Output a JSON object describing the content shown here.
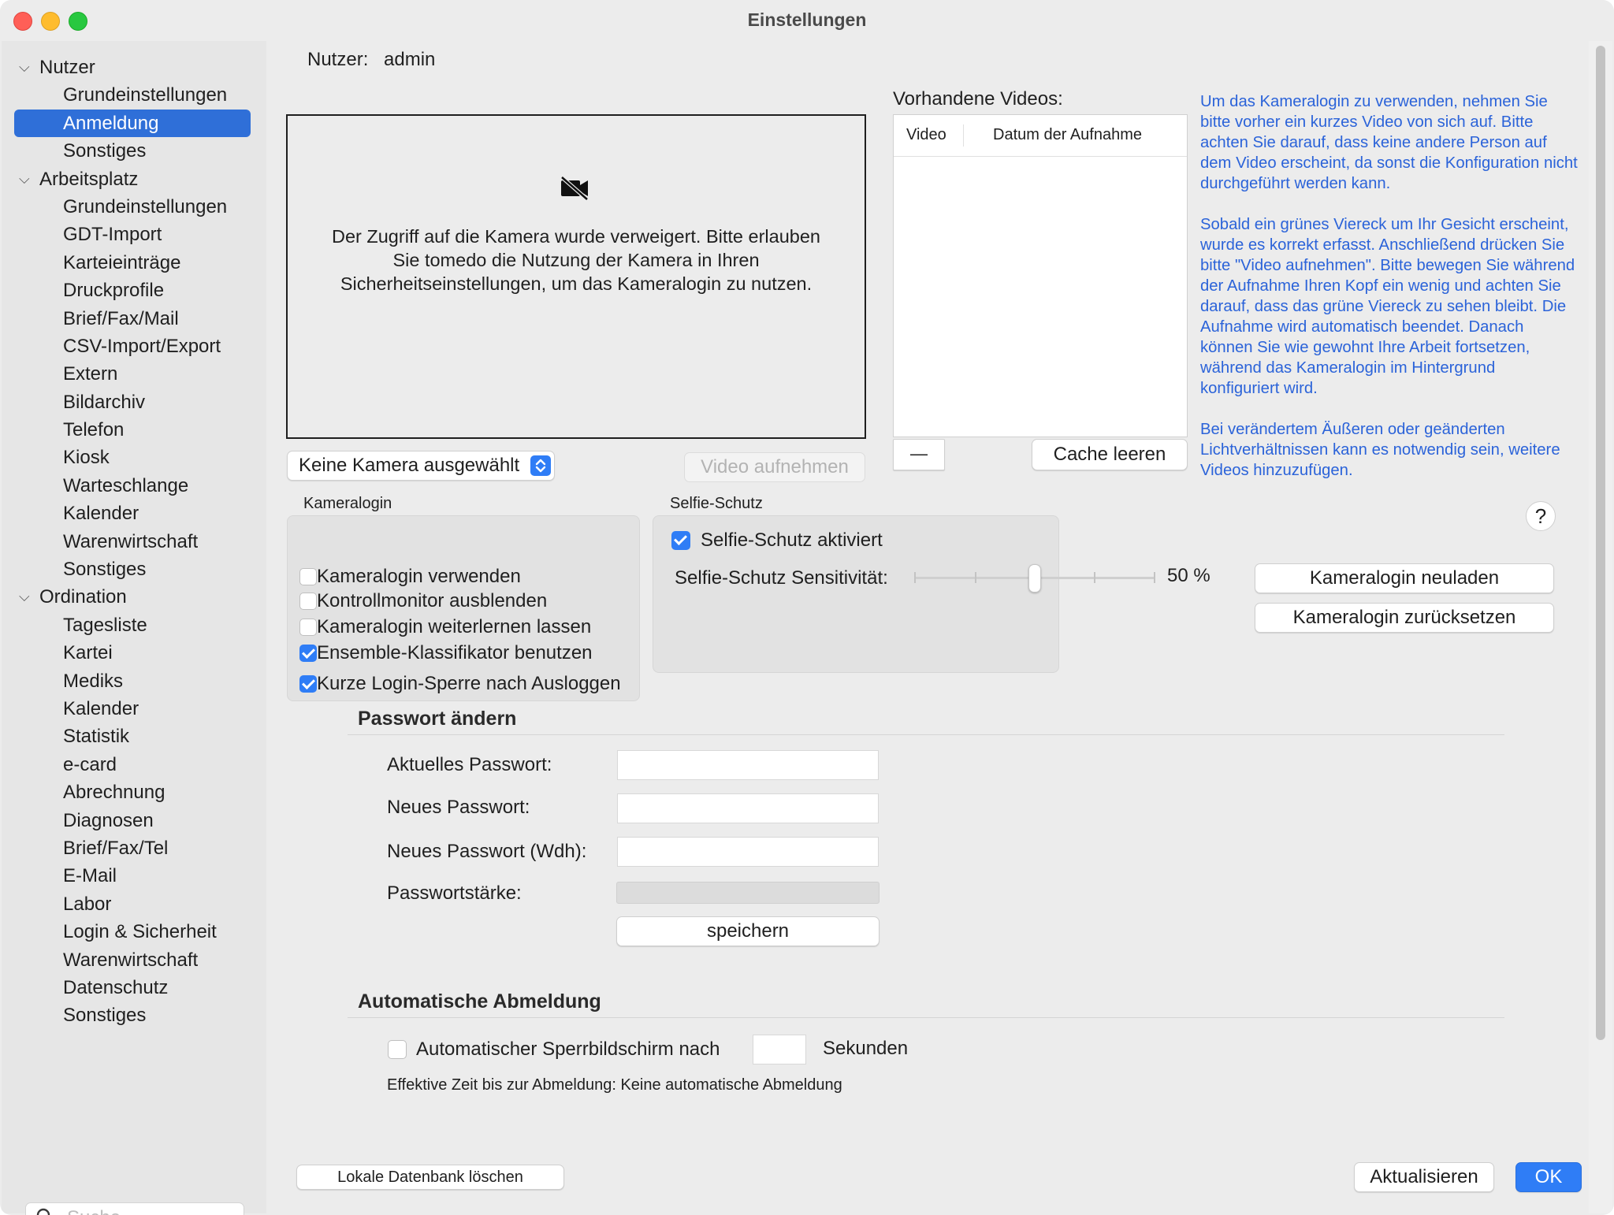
{
  "window": {
    "title": "Einstellungen"
  },
  "sidebar": {
    "items": [
      {
        "label": "Nutzer",
        "type": "group"
      },
      {
        "label": "Grundeinstellungen",
        "type": "child"
      },
      {
        "label": "Anmeldung",
        "type": "child",
        "selected": true
      },
      {
        "label": "Sonstiges",
        "type": "child"
      },
      {
        "label": "Arbeitsplatz",
        "type": "group"
      },
      {
        "label": "Grundeinstellungen",
        "type": "child"
      },
      {
        "label": "GDT-Import",
        "type": "child"
      },
      {
        "label": "Karteieinträge",
        "type": "child"
      },
      {
        "label": "Druckprofile",
        "type": "child"
      },
      {
        "label": "Brief/Fax/Mail",
        "type": "child"
      },
      {
        "label": "CSV-Import/Export",
        "type": "child"
      },
      {
        "label": "Extern",
        "type": "child"
      },
      {
        "label": "Bildarchiv",
        "type": "child"
      },
      {
        "label": "Telefon",
        "type": "child"
      },
      {
        "label": "Kiosk",
        "type": "child"
      },
      {
        "label": "Warteschlange",
        "type": "child"
      },
      {
        "label": "Kalender",
        "type": "child"
      },
      {
        "label": "Warenwirtschaft",
        "type": "child"
      },
      {
        "label": "Sonstiges",
        "type": "child"
      },
      {
        "label": "Ordination",
        "type": "group"
      },
      {
        "label": "Tagesliste",
        "type": "child"
      },
      {
        "label": "Kartei",
        "type": "child"
      },
      {
        "label": "Mediks",
        "type": "child"
      },
      {
        "label": "Kalender",
        "type": "child"
      },
      {
        "label": "Statistik",
        "type": "child"
      },
      {
        "label": "e-card",
        "type": "child"
      },
      {
        "label": "Abrechnung",
        "type": "child"
      },
      {
        "label": "Diagnosen",
        "type": "child"
      },
      {
        "label": "Brief/Fax/Tel",
        "type": "child"
      },
      {
        "label": "E-Mail",
        "type": "child"
      },
      {
        "label": "Labor",
        "type": "child"
      },
      {
        "label": "Login & Sicherheit",
        "type": "child"
      },
      {
        "label": "Warenwirtschaft",
        "type": "child"
      },
      {
        "label": "Datenschutz",
        "type": "child"
      },
      {
        "label": "Sonstiges",
        "type": "child"
      }
    ],
    "search_placeholder": "Suche"
  },
  "user": {
    "label": "Nutzer:",
    "value": "admin"
  },
  "camera": {
    "message": "Der Zugriff auf die Kamera wurde verweigert. Bitte erlauben Sie tomedo die Nutzung der Kamera in Ihren Sicherheitseinstellungen, um das Kameralogin zu nutzen.",
    "select_label": "Keine Kamera ausgewählt",
    "record_button": "Video aufnehmen"
  },
  "videos": {
    "title": "Vorhandene Videos:",
    "columns": [
      "Video",
      "Datum der Aufnahme"
    ],
    "remove_button": "—",
    "clear_cache_button": "Cache leeren"
  },
  "info": {
    "paragraphs": [
      "Um das Kameralogin zu verwenden, nehmen Sie bitte vorher ein kurzes Video von sich auf. Bitte achten Sie darauf, dass keine andere Person auf dem Video erscheint, da sonst die Konfiguration nicht durchgeführt werden kann.",
      "Sobald ein grünes Viereck um Ihr Gesicht erscheint, wurde es korrekt erfasst. Anschließend drücken Sie bitte \"Video aufnehmen\". Bitte bewegen Sie während der Aufnahme Ihren Kopf ein wenig und achten Sie darauf, dass das grüne Viereck zu sehen bleibt. Die Aufnahme wird automatisch beendet. Danach können Sie wie gewohnt Ihre Arbeit fortsetzen, während das Kameralogin im Hintergrund konfiguriert wird.",
      "Bei verändertem Äußeren oder geänderten Lichtverhältnissen kann es notwendig sein, weitere Videos hinzuzufügen."
    ],
    "help_label": "?"
  },
  "kameralogin": {
    "title": "Kameralogin",
    "options": [
      {
        "label": "Kameralogin verwenden",
        "checked": false
      },
      {
        "label": "Kontrollmonitor ausblenden",
        "checked": false
      },
      {
        "label": "Kameralogin weiterlernen lassen",
        "checked": false
      },
      {
        "label": "Ensemble-Klassifikator benutzen",
        "checked": true
      },
      {
        "label": "Kurze Login-Sperre nach Ausloggen",
        "checked": true
      }
    ]
  },
  "selfie": {
    "title": "Selfie-Schutz",
    "enabled_label": "Selfie-Schutz aktiviert",
    "enabled": true,
    "sensitivity_label": "Selfie-Schutz Sensitivität:",
    "sensitivity_value": 50,
    "sensitivity_text": "50 %"
  },
  "actions": {
    "reload": "Kameralogin neuladen",
    "reset": "Kameralogin zurücksetzen"
  },
  "password": {
    "title": "Passwort ändern",
    "current_label": "Aktuelles Passwort:",
    "new_label": "Neues Passwort:",
    "repeat_label": "Neues Passwort (Wdh):",
    "strength_label": "Passwortstärke:",
    "strength_value": 0,
    "save_button": "speichern"
  },
  "autologout": {
    "title": "Automatische Abmeldung",
    "checkbox_label": "Automatischer Sperrbildschirm nach",
    "checked": false,
    "seconds_value": "",
    "unit_label": "Sekunden",
    "effective_text": "Effektive Zeit bis zur Abmeldung: Keine automatische Abmeldung"
  },
  "footer": {
    "delete_db": "Lokale Datenbank löschen",
    "refresh": "Aktualisieren",
    "ok": "OK"
  },
  "colors": {
    "accent": "#2f7df6",
    "info_text": "#2b63d9",
    "selection": "#2f6fd8"
  }
}
